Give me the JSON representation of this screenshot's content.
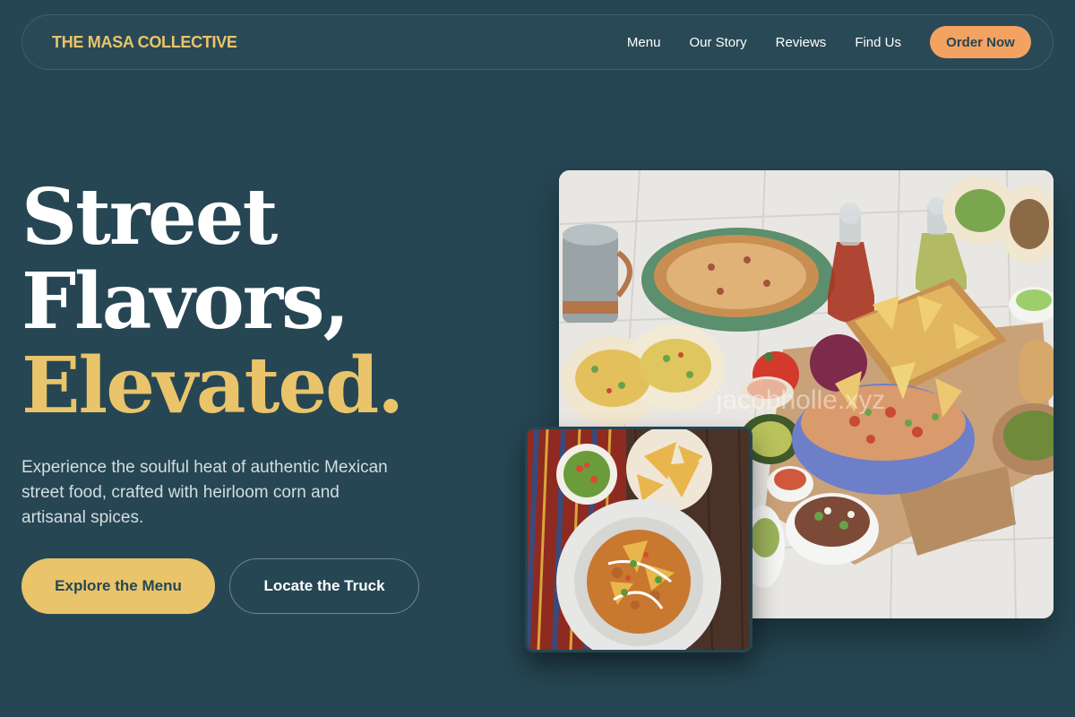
{
  "nav": {
    "brand": "THE MASA COLLECTIVE",
    "links": [
      "Menu",
      "Our Story",
      "Reviews",
      "Find Us"
    ],
    "cta": "Order Now"
  },
  "hero": {
    "title_line1": "Street",
    "title_line2": "Flavors,",
    "title_line3": "Elevated.",
    "subtitle": "Experience the soulful heat of authentic Mexican street food, crafted with heirloom corn and artisanal spices.",
    "primary_button": "Explore the Menu",
    "secondary_button": "Locate the Truck"
  },
  "images": {
    "main_watermark": "jacobholle.xyz"
  },
  "colors": {
    "background": "#264653",
    "accent_gold": "#e9c46a",
    "accent_orange": "#f4a261",
    "text_light": "#ffffff"
  }
}
